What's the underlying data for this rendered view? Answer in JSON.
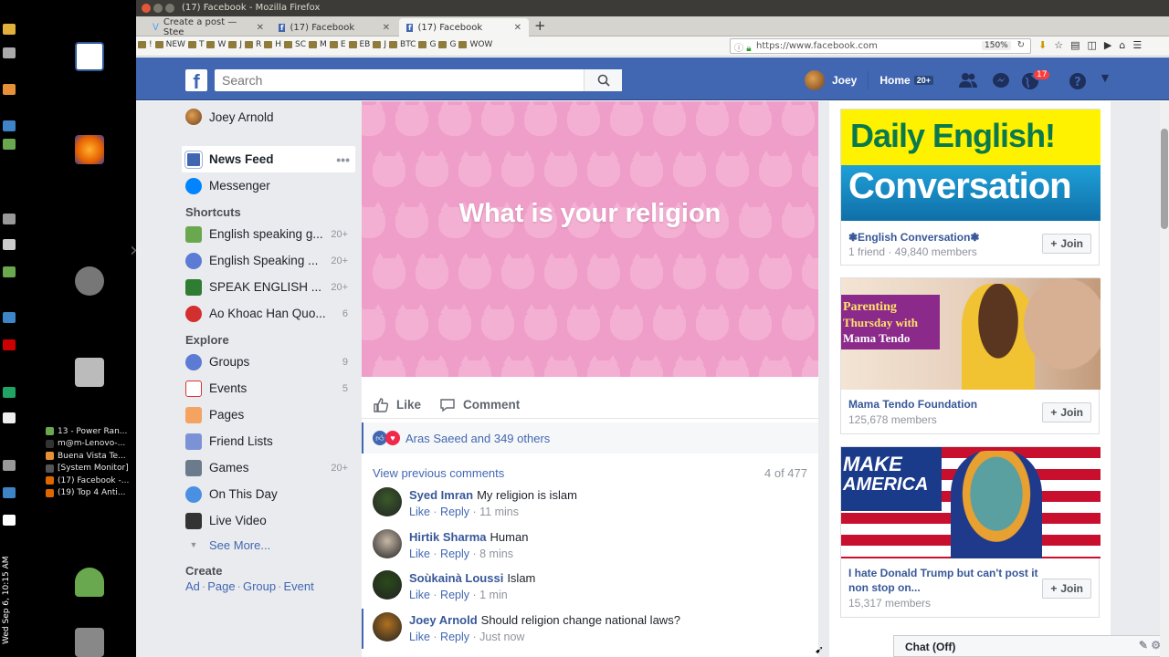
{
  "desktop": {
    "clock": "Wed Sep 6, 10:15 AM",
    "language": "en",
    "taskbar": [
      {
        "label": "13 - Power Ran...",
        "color": "#6aa84f"
      },
      {
        "label": "m@m-Lenovo-...",
        "color": "#333333"
      },
      {
        "label": "Buena Vista Te...",
        "color": "#e69138"
      },
      {
        "label": "[System Monitor]",
        "color": "#555555"
      },
      {
        "label": "(17) Facebook -...",
        "color": "#e06600"
      },
      {
        "label": "(19) Top 4 Anti...",
        "color": "#e06600"
      }
    ]
  },
  "browser": {
    "window_title": "(17) Facebook - Mozilla Firefox",
    "tabs": [
      {
        "label": "Create a post — Stee",
        "icon": "steemit-icon"
      },
      {
        "label": "(17) Facebook",
        "icon": "facebook-icon"
      },
      {
        "label": "(17) Facebook",
        "icon": "facebook-icon",
        "active": true
      }
    ],
    "url": "https://www.facebook.com",
    "zoom": "150%",
    "bookmarks": [
      "!",
      "NEW",
      "T",
      "W",
      "J",
      "R",
      "H",
      "SC",
      "M",
      "E",
      "EB",
      "J",
      "BTC",
      "G",
      "G",
      "WOW"
    ]
  },
  "fb": {
    "search_placeholder": "Search",
    "user_name": "Joey",
    "home_label": "Home",
    "home_count": "20+",
    "notification_count": "17",
    "left": {
      "profile_name": "Joey Arnold",
      "news_feed": "News Feed",
      "messenger": "Messenger",
      "shortcuts_title": "Shortcuts",
      "shortcuts": [
        {
          "label": "English speaking g...",
          "count": "20+"
        },
        {
          "label": "English Speaking ...",
          "count": "20+"
        },
        {
          "label": "SPEAK ENGLISH ...",
          "count": "20+"
        },
        {
          "label": "Ao Khoac Han Quo...",
          "count": "6"
        }
      ],
      "explore_title": "Explore",
      "explore": [
        {
          "label": "Groups",
          "count": "9"
        },
        {
          "label": "Events",
          "count": "5"
        },
        {
          "label": "Pages",
          "count": ""
        },
        {
          "label": "Friend Lists",
          "count": ""
        },
        {
          "label": "Games",
          "count": "20+"
        },
        {
          "label": "On This Day",
          "count": ""
        },
        {
          "label": "Live Video",
          "count": ""
        }
      ],
      "see_more": "See More...",
      "create_title": "Create",
      "create_links": [
        "Ad",
        "Page",
        "Group",
        "Event"
      ]
    },
    "post": {
      "text": "What is your religion",
      "like": "Like",
      "comment": "Comment",
      "reactions_text": "Aras Saeed and 349 others",
      "view_previous": "View previous comments",
      "comment_count": "4 of 477",
      "comments": [
        {
          "name": "Syed Imran",
          "text": "My religion is islam",
          "time": "11 mins"
        },
        {
          "name": "Hirtik Sharma",
          "text": "Human",
          "time": "8 mins"
        },
        {
          "name": "Soùkainà Loussi",
          "text": "Islam",
          "time": "1 min"
        },
        {
          "name": "Joey Arnold",
          "text": "Should religion change national laws?",
          "time": "Just now"
        }
      ],
      "like_label": "Like",
      "reply_label": "Reply"
    },
    "groups": [
      {
        "name": "❃English Conversation❃",
        "meta": "1 friend · 49,840 members",
        "join": "Join",
        "img_line1": "Daily English!",
        "img_line2": "Conversation"
      },
      {
        "name": "Mama Tendo Foundation",
        "meta": "125,678 members",
        "join": "Join",
        "img_line1": "Parenting",
        "img_line2": "Thursday with",
        "img_line3": "Mama Tendo"
      },
      {
        "name": "I hate Donald Trump but can't post it non stop on...",
        "meta": "15,317 members",
        "join": "Join",
        "img_line1": "MAKE",
        "img_line2": "AMERICA"
      }
    ],
    "chat_label": "Chat (Off)"
  }
}
